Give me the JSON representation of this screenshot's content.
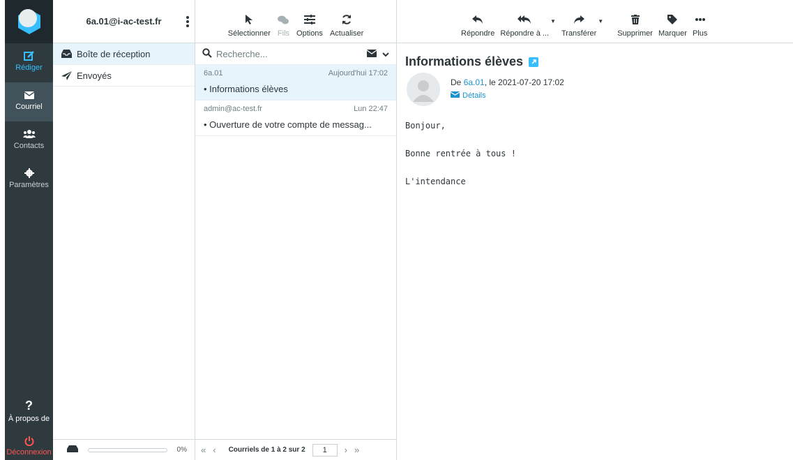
{
  "account": {
    "email": "6a.01@i-ac-test.fr"
  },
  "nav": {
    "compose": "Rédiger",
    "mail": "Courriel",
    "contacts": "Contacts",
    "settings": "Paramètres",
    "about": "À propos de",
    "logout": "Déconnexion"
  },
  "folders": [
    {
      "label": "Boîte de réception",
      "icon": "inbox-icon"
    },
    {
      "label": "Envoyés",
      "icon": "paper-plane-icon"
    }
  ],
  "quota": {
    "percent_label": "0%",
    "fraction": 0
  },
  "list_toolbar": {
    "select": "Sélectionner",
    "threads": "Fils",
    "options": "Options",
    "refresh": "Actualiser"
  },
  "search": {
    "placeholder": "Recherche..."
  },
  "messages": [
    {
      "from": "6a.01",
      "date": "Aujourd'hui 17:02",
      "subject": "Informations élèves",
      "selected": true
    },
    {
      "from": "admin@ac-test.fr",
      "date": "Lun 22:47",
      "subject": "Ouverture de votre compte de messag...",
      "selected": false
    }
  ],
  "pager": {
    "count": "Courriels de 1 à 2 sur 2",
    "page": "1"
  },
  "reader_toolbar": {
    "reply": "Répondre",
    "reply_all": "Répondre à ...",
    "forward": "Transférer",
    "delete": "Supprimer",
    "mark": "Marquer",
    "more": "Plus"
  },
  "reader": {
    "subject": "Informations élèves",
    "from_prefix": "De ",
    "from_name": "6a.01",
    "from_date": ", le 2021-07-20 17:02",
    "details": "Détails",
    "body": [
      "Bonjour,",
      "Bonne rentrée à tous !",
      "L'intendance"
    ]
  },
  "colors": {
    "accent": "#37beff",
    "rail": "#2f3a3f",
    "selected": "#e8f4fb",
    "logout": "#ff5552"
  }
}
